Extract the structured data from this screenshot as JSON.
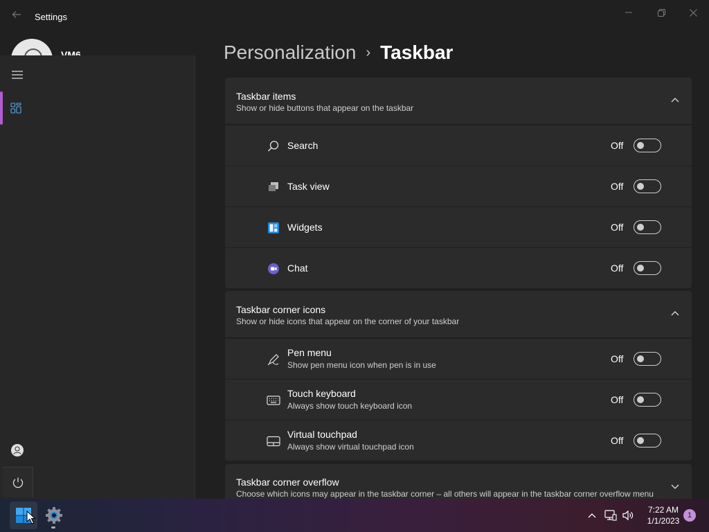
{
  "window": {
    "title": "Settings",
    "user_name": "VM6"
  },
  "breadcrumb": {
    "parent": "Personalization",
    "separator": "›",
    "current": "Taskbar"
  },
  "taskbar_items": {
    "title": "Taskbar items",
    "subtitle": "Show or hide buttons that appear on the taskbar",
    "expanded": true,
    "rows": [
      {
        "label": "Search",
        "icon": "search-icon",
        "state": "Off",
        "on": false
      },
      {
        "label": "Task view",
        "icon": "task-view-icon",
        "state": "Off",
        "on": false
      },
      {
        "label": "Widgets",
        "icon": "widgets-icon",
        "state": "Off",
        "on": false
      },
      {
        "label": "Chat",
        "icon": "chat-icon",
        "state": "Off",
        "on": false
      }
    ]
  },
  "corner_icons": {
    "title": "Taskbar corner icons",
    "subtitle": "Show or hide icons that appear on the corner of your taskbar",
    "expanded": true,
    "rows": [
      {
        "label": "Pen menu",
        "desc": "Show pen menu icon when pen is in use",
        "icon": "pen-icon",
        "state": "Off",
        "on": false
      },
      {
        "label": "Touch keyboard",
        "desc": "Always show touch keyboard icon",
        "icon": "keyboard-icon",
        "state": "Off",
        "on": false
      },
      {
        "label": "Virtual touchpad",
        "desc": "Always show virtual touchpad icon",
        "icon": "touchpad-icon",
        "state": "Off",
        "on": false
      }
    ]
  },
  "corner_overflow": {
    "title": "Taskbar corner overflow",
    "subtitle": "Choose which icons may appear in the taskbar corner – all others will appear in the taskbar corner overflow menu",
    "expanded": false
  },
  "taskbar": {
    "time": "7:22 AM",
    "date": "1/1/2023",
    "notification_count": "1"
  },
  "colors": {
    "accent": "#b15cd1",
    "window_bg": "#202020",
    "card_bg": "#2b2b2b",
    "nav_bg": "#272727"
  }
}
